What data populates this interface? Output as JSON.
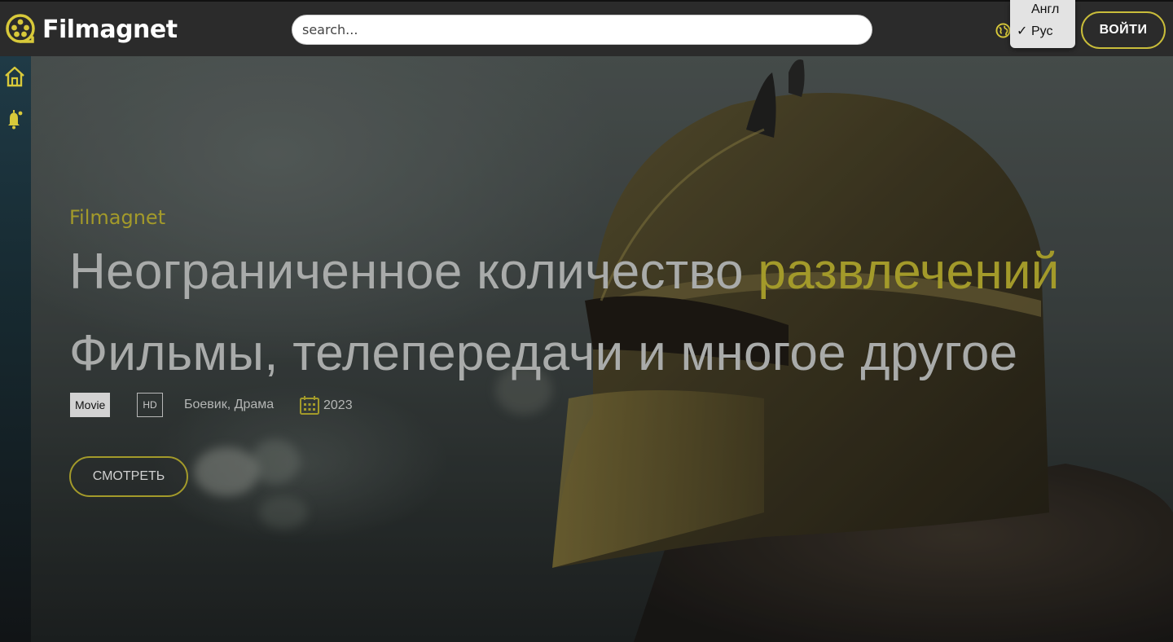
{
  "header": {
    "brand": "Filmagnet",
    "search_placeholder": "search...",
    "language_menu": {
      "options": [
        {
          "label": "Англ",
          "checked": false
        },
        {
          "label": "Рус",
          "checked": true
        }
      ],
      "check_glyph": "✓"
    },
    "login_label": "ВОЙТИ"
  },
  "sidebar": {
    "items": [
      {
        "icon": "home-icon"
      },
      {
        "icon": "bell-icon"
      }
    ]
  },
  "hero": {
    "brand_label": "Filmagnet",
    "headline_line1": "Неограниченное количество ",
    "headline_accent": "развлечений",
    "headline_line2": "Фильмы, телепередачи и многое другое",
    "badge_type": "Movie",
    "badge_quality": "HD",
    "genres": "Боевик, Драма",
    "year": "2023",
    "watch_label": "СМОТРЕТЬ"
  },
  "colors": {
    "accent": "#a39a2a",
    "accent_bright": "#c9bd3a",
    "header_bg": "#2b2b2b"
  }
}
